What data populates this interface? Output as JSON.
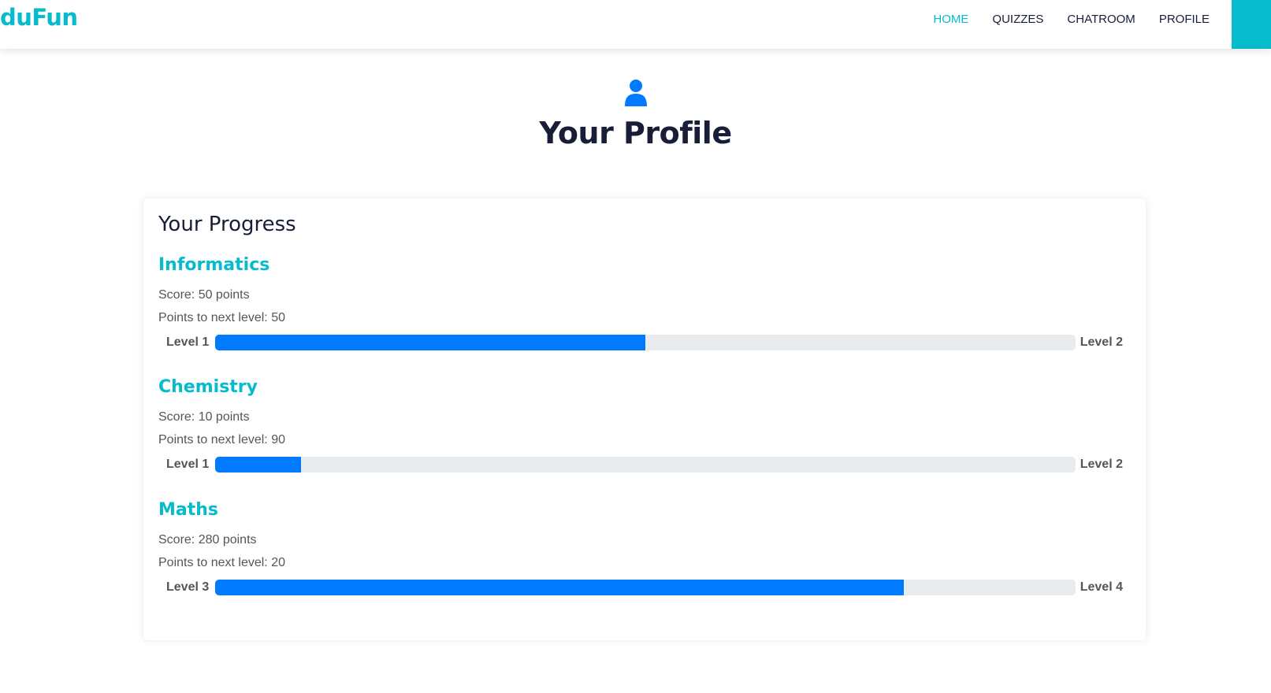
{
  "nav": {
    "brand": "duFun",
    "links": [
      {
        "label": "HOME",
        "active": true
      },
      {
        "label": "QUIZZES",
        "active": false
      },
      {
        "label": "CHATROOM",
        "active": false
      },
      {
        "label": "PROFILE",
        "active": false
      }
    ]
  },
  "header": {
    "icon": "user-icon",
    "title": "Your Profile"
  },
  "progress": {
    "title": "Your Progress",
    "subjects": [
      {
        "name": "Informatics",
        "score": "Score: 50 points",
        "next": "Points to next level: 50",
        "level_from": "Level 1",
        "level_to": "Level 2",
        "percent": 50
      },
      {
        "name": "Chemistry",
        "score": "Score: 10 points",
        "next": "Points to next level: 90",
        "level_from": "Level 1",
        "level_to": "Level 2",
        "percent": 10
      },
      {
        "name": "Maths",
        "score": "Score: 280 points",
        "next": "Points to next level: 20",
        "level_from": "Level 3",
        "level_to": "Level 4",
        "percent": 80
      }
    ]
  },
  "colors": {
    "accent": "#06bbcc",
    "bar": "#007bff",
    "track": "#e9ecef",
    "heading": "#181d38"
  }
}
